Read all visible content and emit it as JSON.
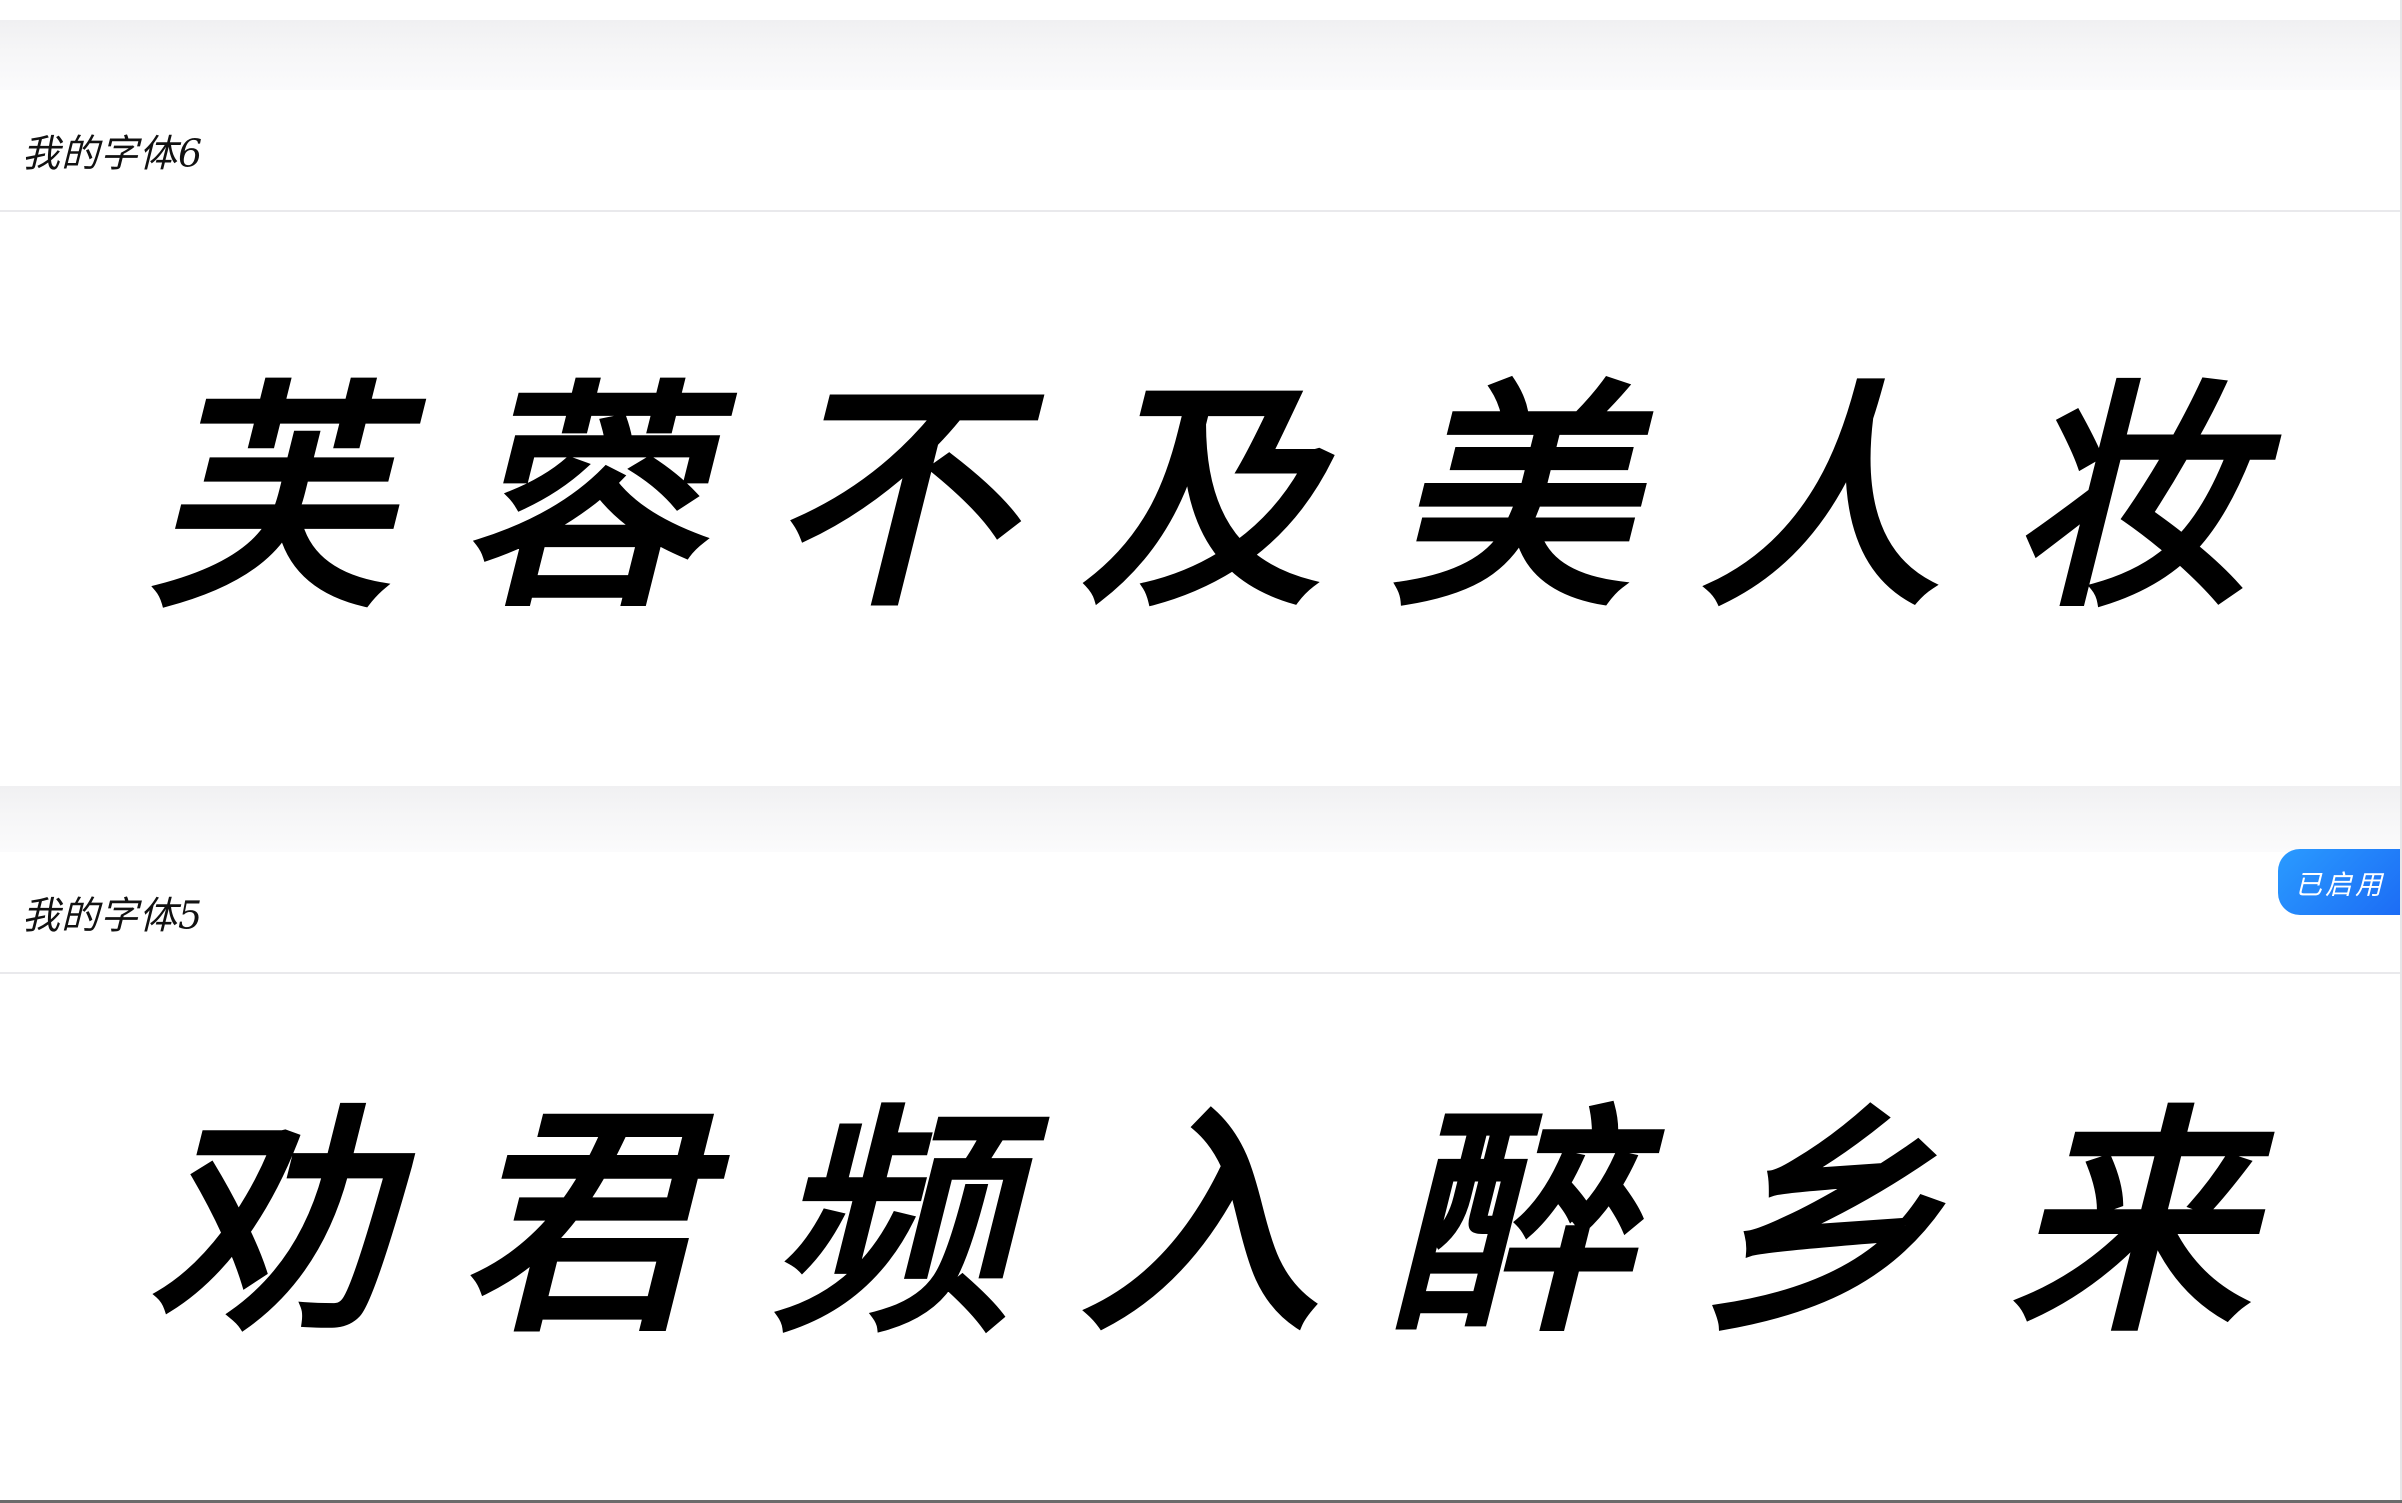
{
  "cards": [
    {
      "name": "我的字体6",
      "sample": "芙蓉不及美人妆",
      "enabled": false
    },
    {
      "name": "我的字体5",
      "sample": "劝君频入醉乡来",
      "enabled": true,
      "badge_label": "已启用"
    }
  ],
  "colors": {
    "badge": "#1f7cf6",
    "text": "#000000",
    "divider": "#e9e9ec",
    "gap": "#f4f4f6"
  }
}
